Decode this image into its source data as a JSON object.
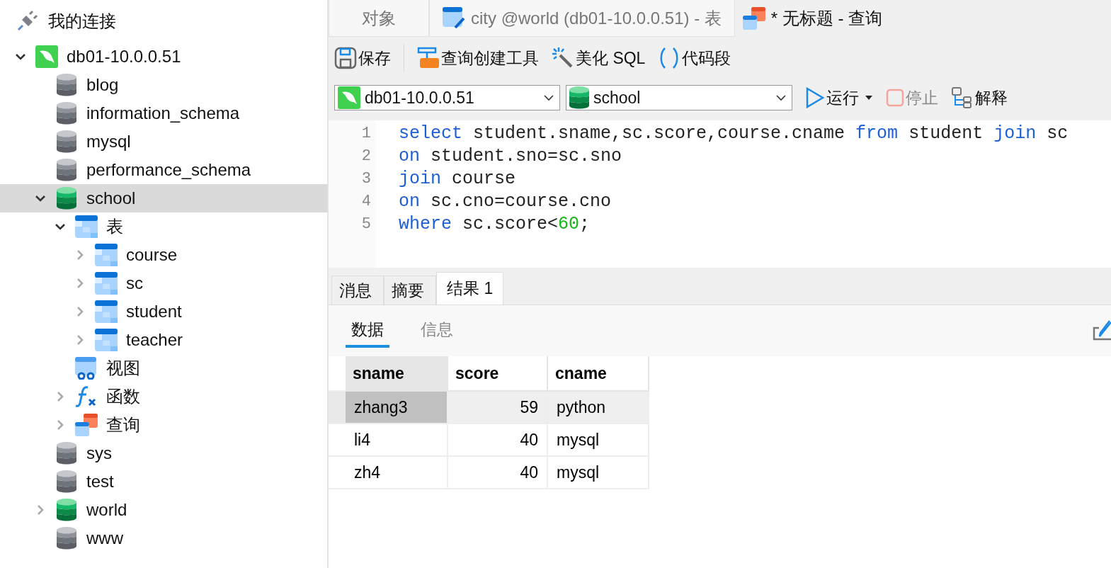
{
  "sidebar": {
    "title": "我的连接",
    "tree": [
      {
        "kind": "connection",
        "label": "db01-10.0.0.51",
        "expanded": true,
        "selected": false,
        "children": [
          {
            "kind": "database",
            "label": "blog",
            "open": false,
            "selected": false
          },
          {
            "kind": "database",
            "label": "information_schema",
            "open": false,
            "selected": false
          },
          {
            "kind": "database",
            "label": "mysql",
            "open": false,
            "selected": false
          },
          {
            "kind": "database",
            "label": "performance_schema",
            "open": false,
            "selected": false
          },
          {
            "kind": "database",
            "label": "school",
            "open": true,
            "expanded": true,
            "selected": true,
            "children": [
              {
                "kind": "tables",
                "label": "表",
                "expanded": true,
                "selected": false,
                "children": [
                  {
                    "kind": "table",
                    "label": "course",
                    "expanded": false,
                    "selected": false
                  },
                  {
                    "kind": "table",
                    "label": "sc",
                    "expanded": false,
                    "selected": false
                  },
                  {
                    "kind": "table",
                    "label": "student",
                    "expanded": false,
                    "selected": false
                  },
                  {
                    "kind": "table",
                    "label": "teacher",
                    "expanded": false,
                    "selected": false
                  }
                ]
              },
              {
                "kind": "views",
                "label": "视图",
                "selected": false
              },
              {
                "kind": "functions",
                "label": "函数",
                "expanded": false,
                "selected": false
              },
              {
                "kind": "queries",
                "label": "查询",
                "expanded": false,
                "selected": false
              }
            ]
          },
          {
            "kind": "database",
            "label": "sys",
            "open": false,
            "selected": false
          },
          {
            "kind": "database",
            "label": "test",
            "open": false,
            "selected": false
          },
          {
            "kind": "database",
            "label": "world",
            "open": true,
            "expanded": false,
            "selected": false
          },
          {
            "kind": "database",
            "label": "www",
            "open": false,
            "selected": false
          }
        ]
      }
    ]
  },
  "tabs": [
    {
      "kind": "objects",
      "label": "对象",
      "selected": false
    },
    {
      "kind": "table",
      "label": "city @world (db01-10.0.0.51) - 表",
      "selected": false
    },
    {
      "kind": "query",
      "label": "* 无标题 - 查询",
      "selected": true
    }
  ],
  "toolbar": [
    {
      "kind": "save",
      "label": "保存"
    },
    {
      "kind": "builder",
      "label": "查询创建工具"
    },
    {
      "kind": "beautify",
      "label": "美化 SQL"
    },
    {
      "kind": "snippet",
      "label": "代码段"
    }
  ],
  "connection_select": {
    "value": "db01-10.0.0.51"
  },
  "database_select": {
    "value": "school"
  },
  "run": {
    "label": "运行"
  },
  "stop": {
    "label": "停止",
    "disabled": true
  },
  "explain": {
    "label": "解释"
  },
  "editor": {
    "lines": [
      {
        "number": "1",
        "tokens": [
          {
            "kind": "keyword",
            "text": "select"
          },
          {
            "kind": "plain",
            "text": " student.sname,sc.score,course.cname "
          },
          {
            "kind": "keyword",
            "text": "from"
          },
          {
            "kind": "plain",
            "text": " student "
          },
          {
            "kind": "keyword",
            "text": "join"
          },
          {
            "kind": "plain",
            "text": " sc"
          }
        ]
      },
      {
        "number": "2",
        "tokens": [
          {
            "kind": "keyword",
            "text": "on"
          },
          {
            "kind": "plain",
            "text": " student.sno=sc.sno"
          }
        ]
      },
      {
        "number": "3",
        "tokens": [
          {
            "kind": "keyword",
            "text": "join"
          },
          {
            "kind": "plain",
            "text": " course"
          }
        ]
      },
      {
        "number": "4",
        "tokens": [
          {
            "kind": "keyword",
            "text": "on"
          },
          {
            "kind": "plain",
            "text": " sc.cno=course.cno"
          }
        ]
      },
      {
        "number": "5",
        "tokens": [
          {
            "kind": "keyword",
            "text": "where"
          },
          {
            "kind": "plain",
            "text": " sc.score<"
          },
          {
            "kind": "number",
            "text": "60"
          },
          {
            "kind": "plain",
            "text": ";"
          }
        ]
      }
    ]
  },
  "result_tabs": [
    {
      "label": "消息",
      "selected": false
    },
    {
      "label": "摘要",
      "selected": false
    },
    {
      "label": "结果 1",
      "selected": true
    }
  ],
  "view_tabs": [
    {
      "label": "数据",
      "selected": true
    },
    {
      "label": "信息",
      "selected": false
    }
  ],
  "grid": {
    "columns": [
      {
        "label": "sname",
        "kind": "text",
        "selected": true
      },
      {
        "label": "score",
        "kind": "number",
        "selected": false
      },
      {
        "label": "cname",
        "kind": "text",
        "selected": false
      }
    ],
    "rows": [
      {
        "cells": [
          "zhang3",
          "59",
          "python"
        ],
        "selected": true
      },
      {
        "cells": [
          "li4",
          "40",
          "mysql"
        ],
        "selected": false
      },
      {
        "cells": [
          "zh4",
          "40",
          "mysql"
        ],
        "selected": false
      }
    ]
  }
}
